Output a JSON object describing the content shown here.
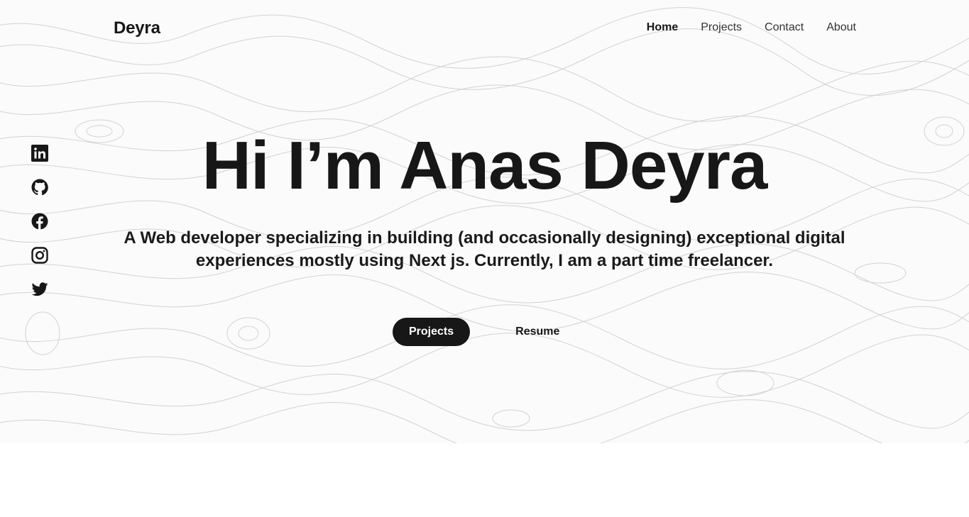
{
  "brand": "Deyra",
  "nav": {
    "items": [
      {
        "label": "Home",
        "active": true
      },
      {
        "label": "Projects",
        "active": false
      },
      {
        "label": "Contact",
        "active": false
      },
      {
        "label": "About",
        "active": false
      }
    ]
  },
  "socials": [
    "linkedin-icon",
    "github-icon",
    "facebook-icon",
    "instagram-icon",
    "twitter-icon"
  ],
  "hero": {
    "headline": "Hi I’m Anas Deyra",
    "tagline": "A Web developer specializing in building (and occasionally designing) exceptional digital experiences mostly using Next js. Currently, I am a part time freelancer.",
    "primary_cta": "Projects",
    "secondary_cta": "Resume"
  },
  "colors": {
    "text": "#171717",
    "button_bg": "#171717",
    "button_text": "#ffffff",
    "hero_bg": "#fbfbfb",
    "page_bg": "#ffffff"
  }
}
